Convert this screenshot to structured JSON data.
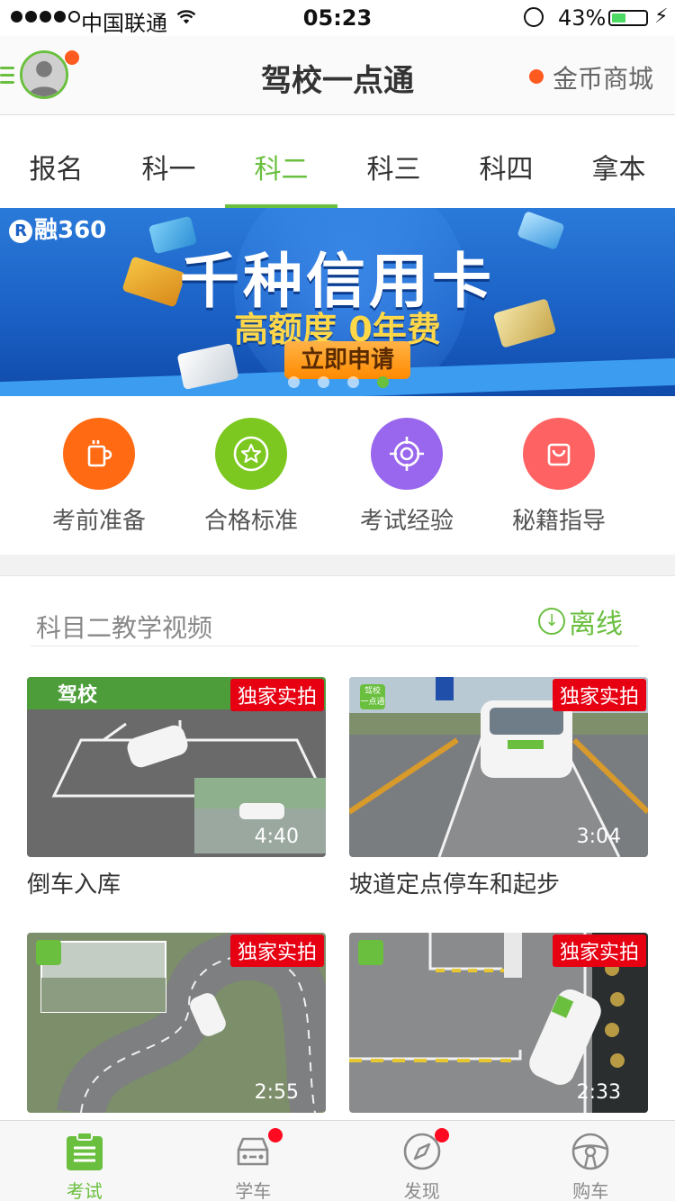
{
  "status_bar": {
    "carrier": "中国联通",
    "time": "05:23",
    "battery": "43%",
    "battery_level": 0.43
  },
  "nav": {
    "title": "驾校一点通",
    "coin_store": "金币商城"
  },
  "tabs": [
    {
      "label": "报名",
      "active": false
    },
    {
      "label": "科一",
      "active": false
    },
    {
      "label": "科二",
      "active": true
    },
    {
      "label": "科三",
      "active": false
    },
    {
      "label": "科四",
      "active": false
    },
    {
      "label": "拿本",
      "active": false
    }
  ],
  "banner": {
    "brand": "融360",
    "headline": "千种信用卡",
    "subline": "高额度 0年费",
    "cta": "立即申请",
    "page_count": 4,
    "active_page": 4
  },
  "quick_links": [
    {
      "label": "考前准备",
      "icon": "cup-icon",
      "color": "#ff6a13"
    },
    {
      "label": "合格标准",
      "icon": "star-badge-icon",
      "color": "#7cc820"
    },
    {
      "label": "考试经验",
      "icon": "target-icon",
      "color": "#9966ee"
    },
    {
      "label": "秘籍指导",
      "icon": "bag-icon",
      "color": "#ff6262"
    }
  ],
  "videos_section": {
    "title": "科目二教学视频",
    "offline_label": "离线"
  },
  "videos": [
    {
      "title": "倒车入库",
      "badge": "独家实拍",
      "duration": "4:40"
    },
    {
      "title": "坡道定点停车和起步",
      "badge": "独家实拍",
      "duration": "3:04"
    },
    {
      "title": "",
      "badge": "独家实拍",
      "duration": "2:55"
    },
    {
      "title": "",
      "badge": "独家实拍",
      "duration": "2:33"
    }
  ],
  "tabbar": [
    {
      "label": "考试",
      "icon": "clipboard-icon",
      "active": true,
      "dot": false
    },
    {
      "label": "学车",
      "icon": "car-icon",
      "active": false,
      "dot": true
    },
    {
      "label": "发现",
      "icon": "compass-icon",
      "active": false,
      "dot": true
    },
    {
      "label": "购车",
      "icon": "steering-wheel-icon",
      "active": false,
      "dot": false
    }
  ],
  "colors": {
    "accent": "#6abf3f",
    "notify": "#ff5a1f",
    "badge": "#e60012"
  }
}
